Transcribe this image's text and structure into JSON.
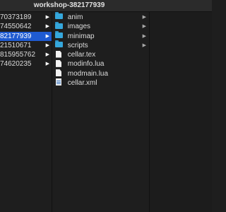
{
  "window": {
    "title": "workshop-382177939"
  },
  "column1": {
    "items": [
      {
        "label": "70373189",
        "selected": false
      },
      {
        "label": "74550642",
        "selected": false
      },
      {
        "label": "82177939",
        "selected": true
      },
      {
        "label": "21510671",
        "selected": false
      },
      {
        "label": "815955762",
        "selected": false
      },
      {
        "label": "74620235",
        "selected": false
      }
    ],
    "arrow": "▶"
  },
  "column2": {
    "items": [
      {
        "label": "anim",
        "icon": "folder-icon",
        "arrow": "▶"
      },
      {
        "label": "images",
        "icon": "folder-icon",
        "arrow": "▶"
      },
      {
        "label": "minimap",
        "icon": "folder-icon",
        "arrow": "▶"
      },
      {
        "label": "scripts",
        "icon": "folder-icon",
        "arrow": "▶"
      },
      {
        "label": "cellar.tex",
        "icon": "document-icon"
      },
      {
        "label": "modinfo.lua",
        "icon": "document-icon"
      },
      {
        "label": "modmain.lua",
        "icon": "document-icon"
      },
      {
        "label": "cellar.xml",
        "icon": "xml-document-icon"
      }
    ]
  },
  "colors": {
    "selection": "#1f5bd1",
    "folder": "#35a7dc",
    "background": "#1e1e1e"
  }
}
